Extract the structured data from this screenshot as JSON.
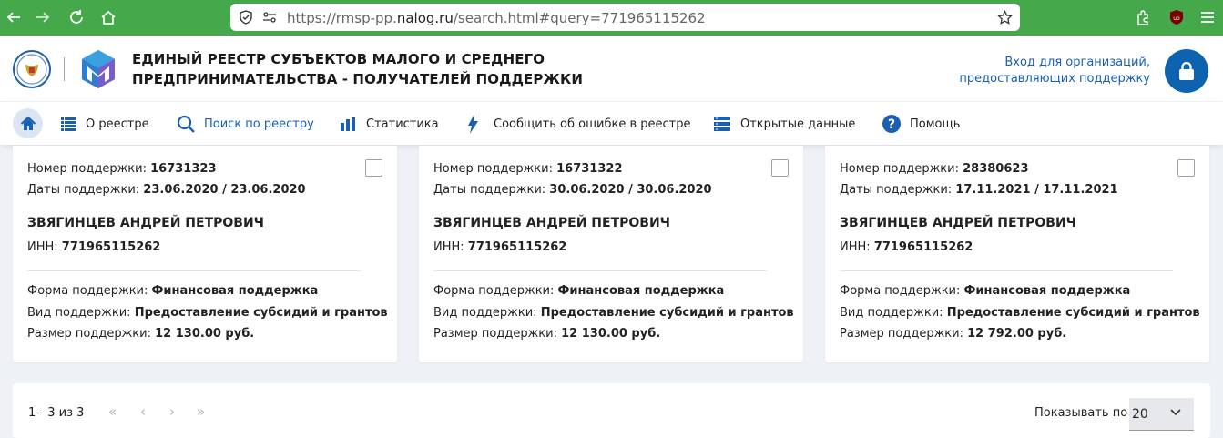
{
  "browser": {
    "url_prefix": "https://rmsp-pp.",
    "url_domain": "nalog.ru",
    "url_suffix": "/search.html#query=771965115262"
  },
  "header": {
    "title_line1": "ЕДИНЫЙ РЕЕСТР СУБЪЕКТОВ МАЛОГО И СРЕДНЕГО",
    "title_line2": "ПРЕДПРИНИМАТЕЛЬСТВА - ПОЛУЧАТЕЛЕЙ ПОДДЕРЖКИ",
    "login_line1": "Вход для организаций,",
    "login_line2": "предоставляющих поддержку"
  },
  "nav": {
    "items": [
      {
        "label": "О реестре",
        "icon": "list-icon"
      },
      {
        "label": "Поиск по реестру",
        "icon": "search-icon"
      },
      {
        "label": "Статистика",
        "icon": "bar-chart-icon"
      },
      {
        "label": "Сообщить об ошибке в реестре",
        "icon": "lightning-icon"
      },
      {
        "label": "Открытые данные",
        "icon": "database-icon"
      },
      {
        "label": "Помощь",
        "icon": "help-icon"
      }
    ]
  },
  "labels": {
    "support_number": "Номер поддержки: ",
    "support_dates": "Даты поддержки: ",
    "inn": "ИНН: ",
    "form": "Форма поддержки: ",
    "kind": "Вид поддержки: ",
    "size": "Размер поддержки: "
  },
  "cards": [
    {
      "number": "16731323",
      "dates": "23.06.2020 / 23.06.2020",
      "name": "ЗВЯГИНЦЕВ АНДРЕЙ ПЕТРОВИЧ",
      "inn": "771965115262",
      "form": "Финансовая поддержка",
      "kind": "Предоставление субсидий и грантов",
      "size": "12 130.00 руб."
    },
    {
      "number": "16731322",
      "dates": "30.06.2020 / 30.06.2020",
      "name": "ЗВЯГИНЦЕВ АНДРЕЙ ПЕТРОВИЧ",
      "inn": "771965115262",
      "form": "Финансовая поддержка",
      "kind": "Предоставление субсидий и грантов",
      "size": "12 130.00 руб."
    },
    {
      "number": "28380623",
      "dates": "17.11.2021 / 17.11.2021",
      "name": "ЗВЯГИНЦЕВ АНДРЕЙ ПЕТРОВИЧ",
      "inn": "771965115262",
      "form": "Финансовая поддержка",
      "kind": "Предоставление субсидий и грантов",
      "size": "12 792.00 руб."
    }
  ],
  "pager": {
    "count": "1 - 3 из 3",
    "first": "«",
    "prev": "‹",
    "next": "›",
    "last": "»",
    "show_label": "Показывать по",
    "page_size": "20"
  },
  "colors": {
    "browser_bar": "#45a84a",
    "accent": "#1a5fb4",
    "lock_button": "#0d63b0"
  }
}
